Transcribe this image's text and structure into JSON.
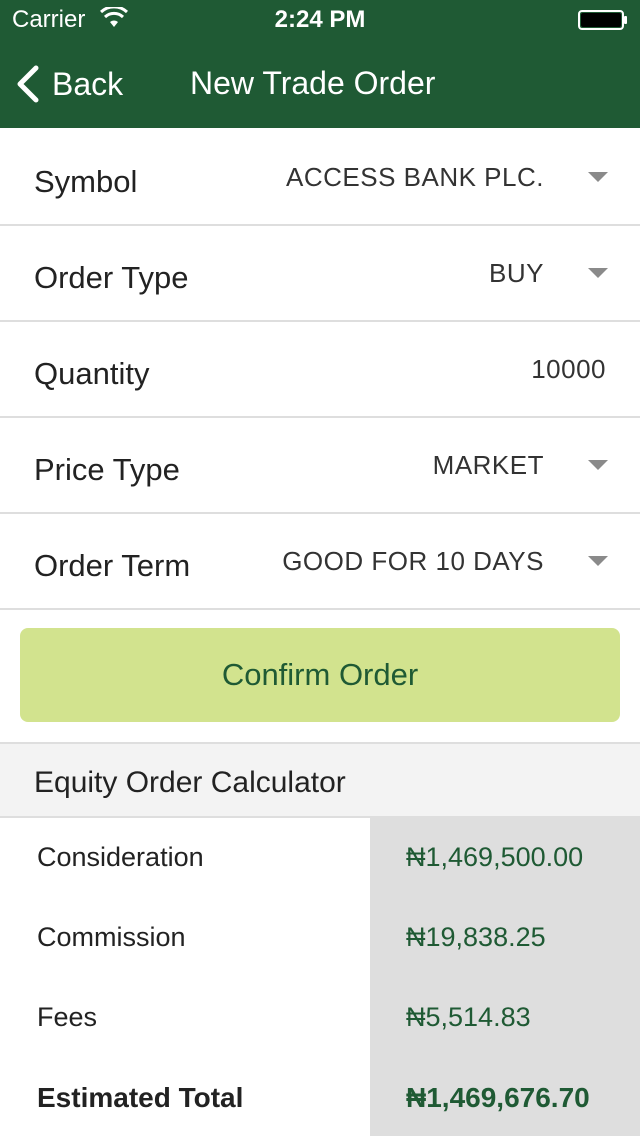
{
  "status_bar": {
    "carrier": "Carrier",
    "time": "2:24 PM"
  },
  "nav": {
    "back_label": "Back",
    "title": "New Trade Order"
  },
  "form": {
    "rows": [
      {
        "label": "Symbol",
        "value": "ACCESS BANK PLC."
      },
      {
        "label": "Order Type",
        "value": "BUY"
      },
      {
        "label": "Quantity",
        "value": "10000"
      },
      {
        "label": "Price Type",
        "value": "MARKET"
      },
      {
        "label": "Order Term",
        "value": "GOOD FOR 10 DAYS"
      }
    ],
    "confirm_label": "Confirm Order"
  },
  "calculator": {
    "title": "Equity Order Calculator",
    "rows": [
      {
        "label": "Consideration",
        "value": "₦1,469,500.00"
      },
      {
        "label": "Commission",
        "value": "₦19,838.25"
      },
      {
        "label": "Fees",
        "value": "₦5,514.83"
      },
      {
        "label": "Estimated Total",
        "value": "₦1,469,676.70"
      }
    ]
  },
  "colors": {
    "header": "#1f5a34",
    "button": "#d2e38e",
    "accent_text": "#1f5a34",
    "calc_value_bg": "#dedede"
  },
  "icons": [
    "wifi-icon",
    "battery-icon",
    "back-chevron-icon",
    "caret-icon"
  ]
}
